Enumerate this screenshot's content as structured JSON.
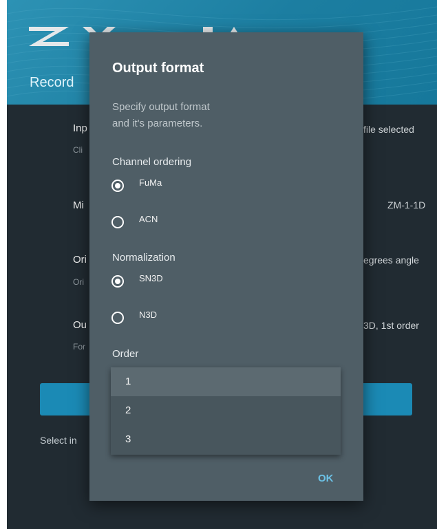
{
  "header": {
    "title": "Record"
  },
  "background_rows": [
    {
      "title": "Inp",
      "subtitle": "Cli",
      "value": "file selected"
    },
    {
      "title": "Mi",
      "subtitle": "",
      "value": "ZM-1-1D"
    },
    {
      "title": "Ori",
      "subtitle": "Ori",
      "value": "egrees angle"
    },
    {
      "title": "Ou",
      "subtitle": "For",
      "value": "3D, 1st order"
    }
  ],
  "bottom_text": "Select in",
  "dialog": {
    "title": "Output format",
    "description": "Specify output format and it's parameters.",
    "channel_ordering": {
      "label": "Channel ordering",
      "options": [
        {
          "label": "FuMa",
          "selected": true
        },
        {
          "label": "ACN",
          "selected": false
        }
      ]
    },
    "normalization": {
      "label": "Normalization",
      "options": [
        {
          "label": "SN3D",
          "selected": true
        },
        {
          "label": "N3D",
          "selected": false
        }
      ]
    },
    "order": {
      "label": "Order",
      "options": [
        "1",
        "2",
        "3"
      ],
      "selected": "1"
    },
    "ok_label": "OK"
  },
  "colors": {
    "header_accent": "#1c7ea1",
    "dialog_bg": "#4f5e66",
    "ok_accent": "#6cc2e6"
  }
}
